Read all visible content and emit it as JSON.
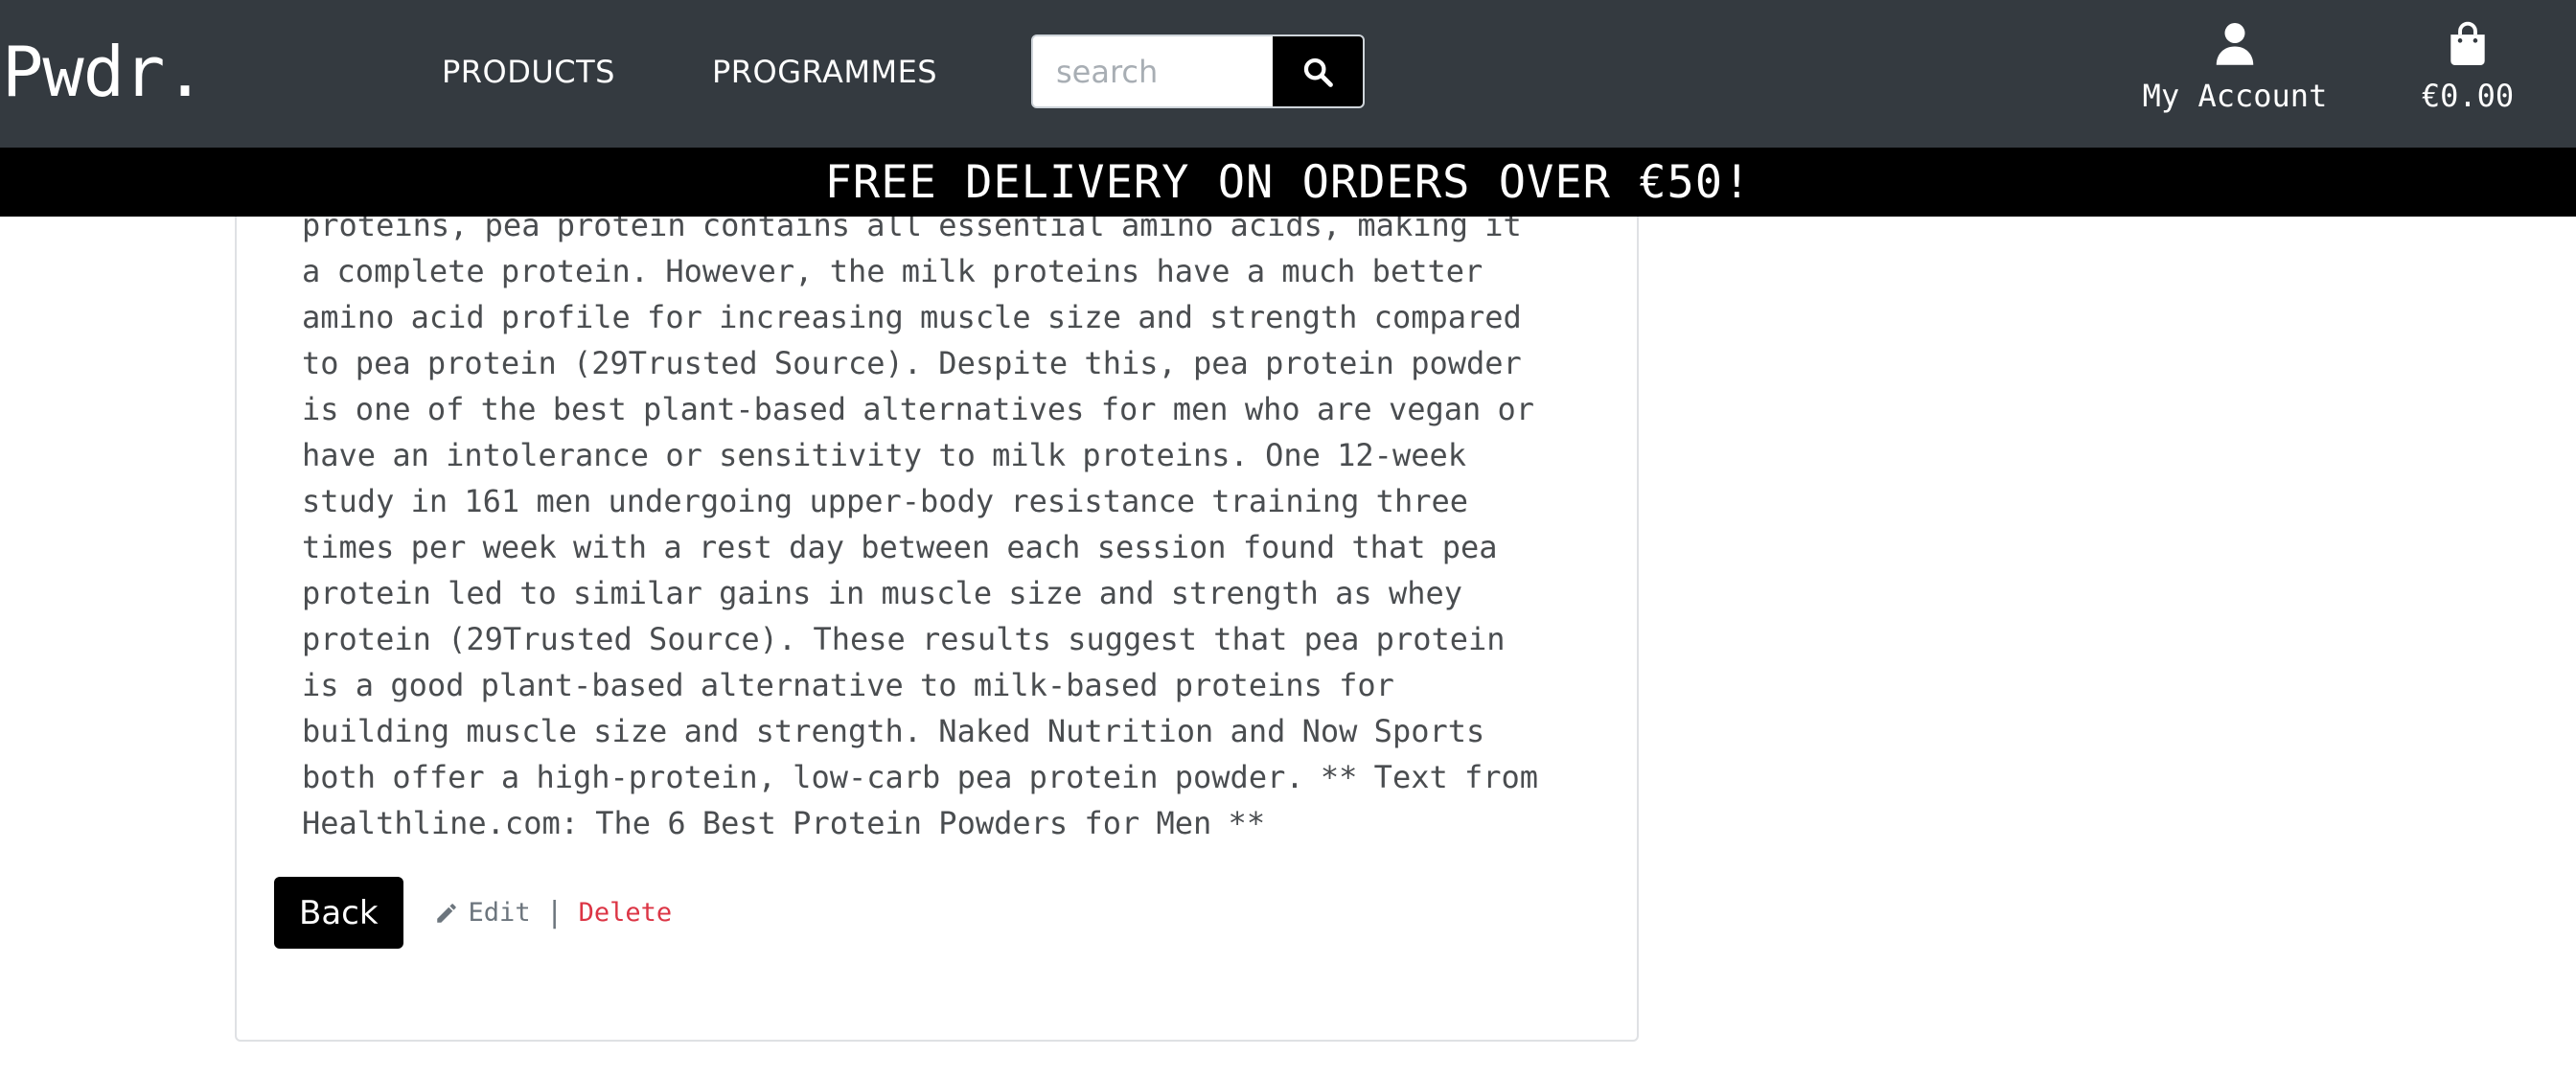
{
  "header": {
    "logo": "Pwdr.",
    "nav": {
      "products": "PRODUCTS",
      "programmes": "PROGRAMMES"
    },
    "search": {
      "placeholder": "search",
      "value": ""
    },
    "account_label": "My Account",
    "cart_total": "€0.00"
  },
  "banner": {
    "text": "FREE DELIVERY ON ORDERS OVER €50!"
  },
  "product": {
    "description_lines": [
      "proteins, pea protein contains all essential amino acids, making it",
      "a complete protein. However, the milk proteins have a much better",
      "amino acid profile for increasing muscle size and strength compared",
      "to pea protein (29Trusted Source). Despite this, pea protein powder",
      "is one of the best plant-based alternatives for men who are vegan or",
      "have an intolerance or sensitivity to milk proteins. One 12-week",
      "study in 161 men undergoing upper-body resistance training three",
      "times per week with a rest day between each session found that pea",
      "protein led to similar gains in muscle size and strength as whey",
      "protein (29Trusted Source). These results suggest that pea protein",
      "is a good plant-based alternative to milk-based proteins for",
      "building muscle size and strength. Naked Nutrition and Now Sports",
      "both offer a high-protein, low-carb pea protein powder. ** Text from",
      "Healthline.com: The 6 Best Protein Powders for Men **"
    ]
  },
  "actions": {
    "back_label": "Back",
    "edit_label": "Edit",
    "separator": "|",
    "delete_label": "Delete"
  },
  "icons": {
    "search": "search-icon",
    "account": "user-icon",
    "cart": "shopping-bag-icon",
    "edit": "pencil-icon"
  },
  "colors": {
    "header_bg": "#343a40",
    "banner_bg": "#000000",
    "delete": "#dc3545",
    "muted": "#6c757d"
  }
}
